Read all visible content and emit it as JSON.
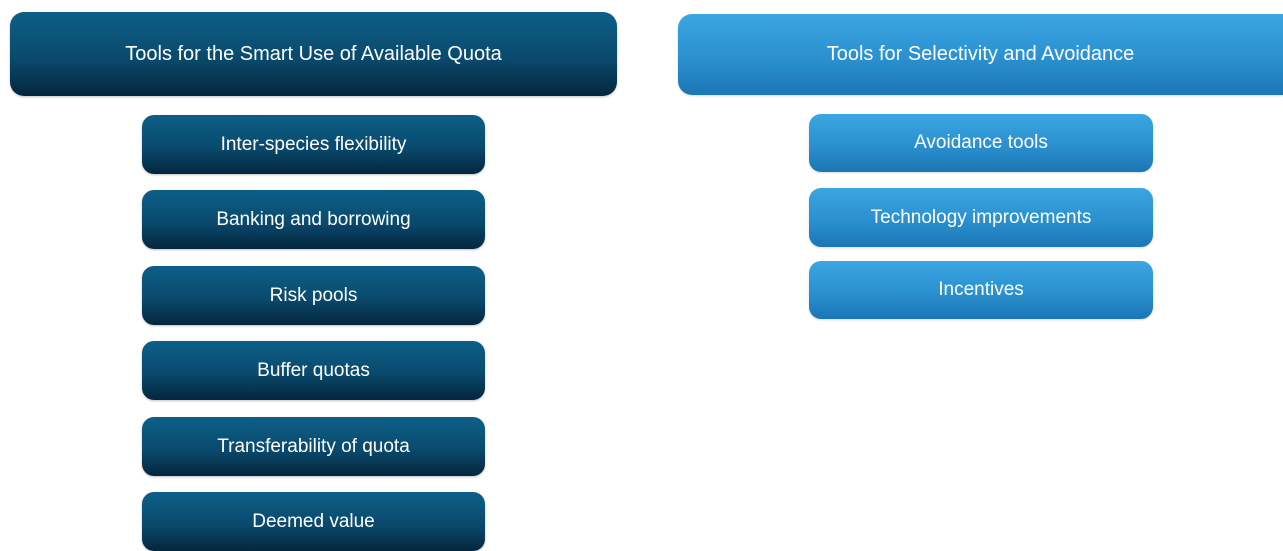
{
  "left_column": {
    "header": "Tools for the Smart Use of Available Quota",
    "items": [
      "Inter-species flexibility",
      "Banking and borrowing",
      "Risk pools",
      "Buffer quotas",
      "Transferability of quota",
      "Deemed value"
    ]
  },
  "right_column": {
    "header": "Tools for Selectivity and Avoidance",
    "items": [
      "Avoidance tools",
      "Technology improvements",
      "Incentives"
    ]
  },
  "colors": {
    "dark_top": "#0d5f88",
    "dark_bottom": "#04263d",
    "light_top": "#3aa6e2",
    "light_bottom": "#1b76b5",
    "text": "#ffffff"
  }
}
